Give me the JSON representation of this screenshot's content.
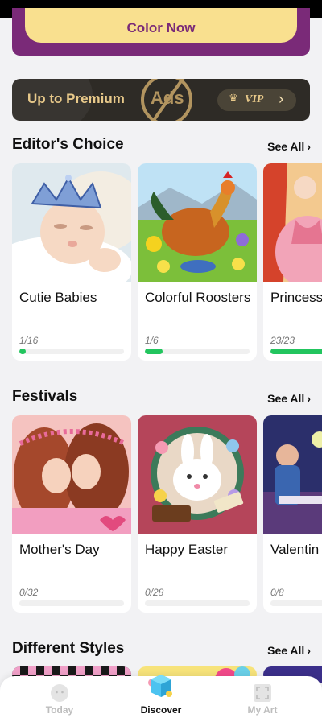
{
  "top_banner": {
    "button_label": "Color Now",
    "bg_color": "#7a2a78",
    "button_color": "#f9e08f"
  },
  "premium": {
    "title": "Up to Premium",
    "ads_label": "Ads",
    "vip_label": "VIP",
    "crown_icon": "crown-icon",
    "chevron": "›"
  },
  "sections": [
    {
      "title": "Editor's Choice",
      "see_all": "See All",
      "cards": [
        {
          "title": "Cutie Babies",
          "progress_text": "1/16",
          "progress": 0.0625
        },
        {
          "title": "Colorful Roosters",
          "progress_text": "1/6",
          "progress": 0.1667
        },
        {
          "title": "Princess",
          "progress_text": "23/23",
          "progress": 1.0
        }
      ]
    },
    {
      "title": "Festivals",
      "see_all": "See All",
      "cards": [
        {
          "title": "Mother's Day",
          "progress_text": "0/32",
          "progress": 0
        },
        {
          "title": "Happy Easter",
          "progress_text": "0/28",
          "progress": 0
        },
        {
          "title": "Valentin",
          "progress_text": "0/8",
          "progress": 0
        }
      ]
    },
    {
      "title": "Different Styles",
      "see_all": "See All"
    }
  ],
  "nav": {
    "items": [
      {
        "label": "Today",
        "icon": "smiley-icon",
        "active": false
      },
      {
        "label": "Discover",
        "icon": "discover-cube-icon",
        "active": true
      },
      {
        "label": "My Art",
        "icon": "frame-icon",
        "active": false
      }
    ]
  },
  "colors": {
    "progress": "#22c55e",
    "track": "#f0f0f0",
    "accent_gold": "#e8c98a"
  }
}
